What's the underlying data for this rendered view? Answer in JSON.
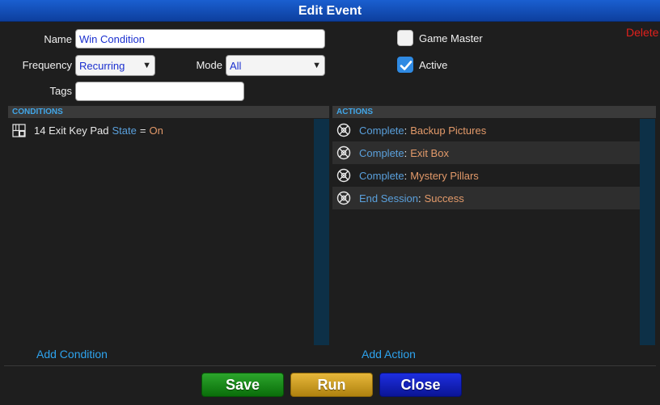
{
  "window": {
    "title": "Edit Event"
  },
  "form": {
    "name_label": "Name",
    "name_value": "Win Condition",
    "frequency_label": "Frequency",
    "frequency_value": "Recurring",
    "mode_label": "Mode",
    "mode_value": "All",
    "tags_label": "Tags",
    "tags_value": "",
    "game_master_label": "Game Master",
    "game_master_checked": false,
    "active_label": "Active",
    "active_checked": true,
    "delete_label": "Delete"
  },
  "conditions": {
    "header": "CONDITIONS",
    "items": [
      {
        "device": "14 Exit Key Pad",
        "property": "State",
        "operator": "=",
        "value": "On"
      }
    ],
    "add_label": "Add Condition"
  },
  "actions": {
    "header": "ACTIONS",
    "items": [
      {
        "verb": "Complete",
        "sep": ":",
        "target": "Backup Pictures"
      },
      {
        "verb": "Complete",
        "sep": ":",
        "target": "Exit Box"
      },
      {
        "verb": "Complete",
        "sep": ":",
        "target": "Mystery Pillars"
      },
      {
        "verb": "End Session",
        "sep": ":",
        "target": "Success"
      }
    ],
    "add_label": "Add Action"
  },
  "footer": {
    "save_label": "Save",
    "run_label": "Run",
    "close_label": "Close"
  },
  "colors": {
    "accent": "#2ea3ee",
    "keyword": "#5aa0dc",
    "value": "#e39a6a",
    "delete": "#e0201c"
  },
  "icons": {
    "condition": "grid-icon",
    "action": "gear-icon",
    "checkbox": "check-icon"
  }
}
